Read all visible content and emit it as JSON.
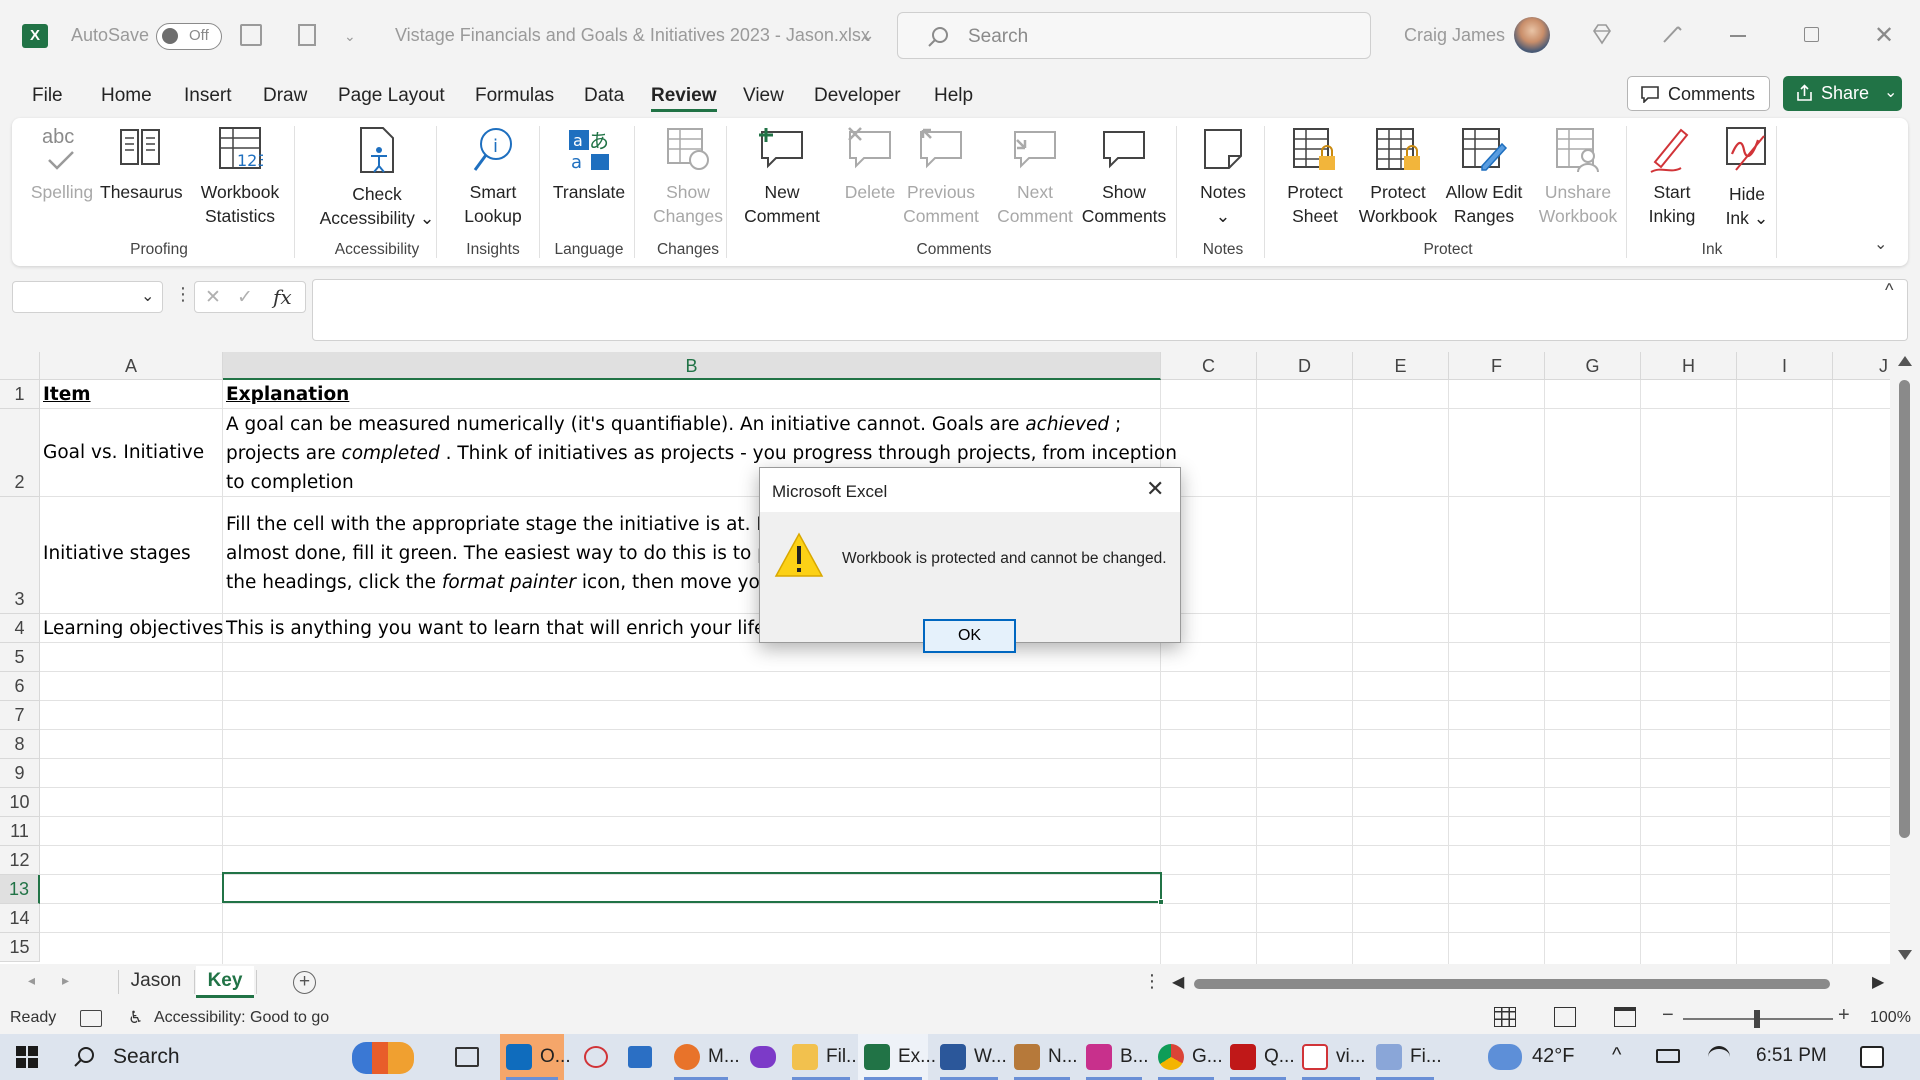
{
  "titlebar": {
    "autosave_label": "AutoSave",
    "autosave_state": "Off",
    "document_title": "Vistage Financials and Goals & Initiatives 2023 - Jason.xlsx",
    "search_placeholder": "Search",
    "user_name": "Craig James"
  },
  "menu": {
    "tabs": [
      "File",
      "Home",
      "Insert",
      "Draw",
      "Page Layout",
      "Formulas",
      "Data",
      "Review",
      "View",
      "Developer",
      "Help"
    ],
    "active": "Review",
    "comments_button": "Comments",
    "share_button": "Share"
  },
  "ribbon": {
    "buttons": [
      {
        "label": "Spelling",
        "disabled": true
      },
      {
        "label": "Thesaurus",
        "disabled": false
      },
      {
        "label": "Workbook\nStatistics",
        "disabled": false
      },
      {
        "label": "Check\nAccessibility ⌄",
        "disabled": false
      },
      {
        "label": "Smart\nLookup",
        "disabled": false
      },
      {
        "label": "Translate",
        "disabled": false
      },
      {
        "label": "Show\nChanges",
        "disabled": true
      },
      {
        "label": "New\nComment",
        "disabled": false
      },
      {
        "label": "Delete",
        "disabled": true
      },
      {
        "label": "Previous\nComment",
        "disabled": true
      },
      {
        "label": "Next\nComment",
        "disabled": true
      },
      {
        "label": "Show\nComments",
        "disabled": false
      },
      {
        "label": "Notes\n⌄",
        "disabled": false
      },
      {
        "label": "Protect\nSheet",
        "disabled": false
      },
      {
        "label": "Protect\nWorkbook",
        "disabled": false
      },
      {
        "label": "Allow Edit\nRanges",
        "disabled": false
      },
      {
        "label": "Unshare\nWorkbook",
        "disabled": true
      },
      {
        "label": "Start\nInking",
        "disabled": false
      },
      {
        "label": "Hide\nInk ⌄",
        "disabled": false
      }
    ],
    "groups": [
      "Proofing",
      "Accessibility",
      "Insights",
      "Language",
      "Changes",
      "Comments",
      "Notes",
      "Protect",
      "Ink"
    ]
  },
  "formula_bar": {
    "fx_label": "fx",
    "name_box": "",
    "formula": ""
  },
  "sheet": {
    "columns": [
      "A",
      "B",
      "C",
      "D",
      "E",
      "F",
      "G",
      "H",
      "I",
      "J"
    ],
    "rows": [
      "1",
      "2",
      "3",
      "4",
      "5",
      "6",
      "7",
      "8",
      "9",
      "10",
      "11",
      "12",
      "13",
      "14",
      "15"
    ],
    "header_item": "Item",
    "header_explanation": "Explanation",
    "r2_item": "Goal vs. Initiative",
    "r2_line1a": "A goal can be measured numerically (it's quantifiable). An initiative cannot. Goals are ",
    "r2_line1b": "achieved",
    "r2_line1c": " ;",
    "r2_line2a": "projects are ",
    "r2_line2b": "completed",
    "r2_line2c": " . Think of initiatives as projects - you progress through projects, from inception",
    "r2_line3": "to completion",
    "r3_item": "Initiative stages",
    "r3_line1": "Fill the cell with the appropriate stage the initiative is at. If t",
    "r3_line2": "almost done, fill it green. The easiest way to do this is to pu",
    "r3_line3a": "the headings, click the ",
    "r3_line3b": "format painter",
    "r3_line3c": "  icon,  then move you",
    "r4_item": "Learning objectives",
    "r4_expl": "This is anything you want to learn that will enrich your life o"
  },
  "sheet_tabs": [
    "Jason",
    "Key"
  ],
  "active_sheet": "Key",
  "statusbar": {
    "ready": "Ready",
    "accessibility": "Accessibility: Good to go",
    "zoom": "100%"
  },
  "dialog": {
    "title": "Microsoft Excel",
    "message": "Workbook is protected and cannot be changed.",
    "ok": "OK"
  },
  "taskbar": {
    "search": "Search",
    "apps": [
      "O...",
      "M...",
      "Fil...",
      "Ex...",
      "W...",
      "N...",
      "B...",
      "G...",
      "Q...",
      "vi...",
      "Fi..."
    ],
    "weather": "42°F",
    "time": "6:51 PM"
  },
  "colors": {
    "excel_green": "#217346",
    "taskbar": "#dde4ee",
    "dialog_button": "#0067c0"
  }
}
